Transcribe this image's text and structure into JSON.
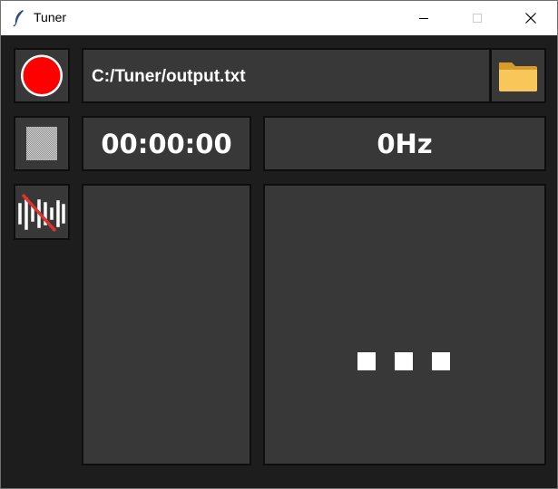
{
  "window": {
    "title": "Tuner",
    "app_icon": "feather-icon"
  },
  "controls": {
    "record_icon": "record-icon",
    "stop_icon": "stop-icon",
    "mute_icon": "microphone-mute-icon",
    "folder_icon": "folder-icon"
  },
  "output": {
    "path": "C:/Tuner/output.txt"
  },
  "display": {
    "timer": "00:00:00",
    "frequency": "0Hz",
    "status_indicator": "loading-dots"
  },
  "colors": {
    "background": "#1d1d1d",
    "panel": "#383838",
    "record_red": "#ff0000",
    "folder_yellow": "#f8c659",
    "text": "#ffffff"
  }
}
